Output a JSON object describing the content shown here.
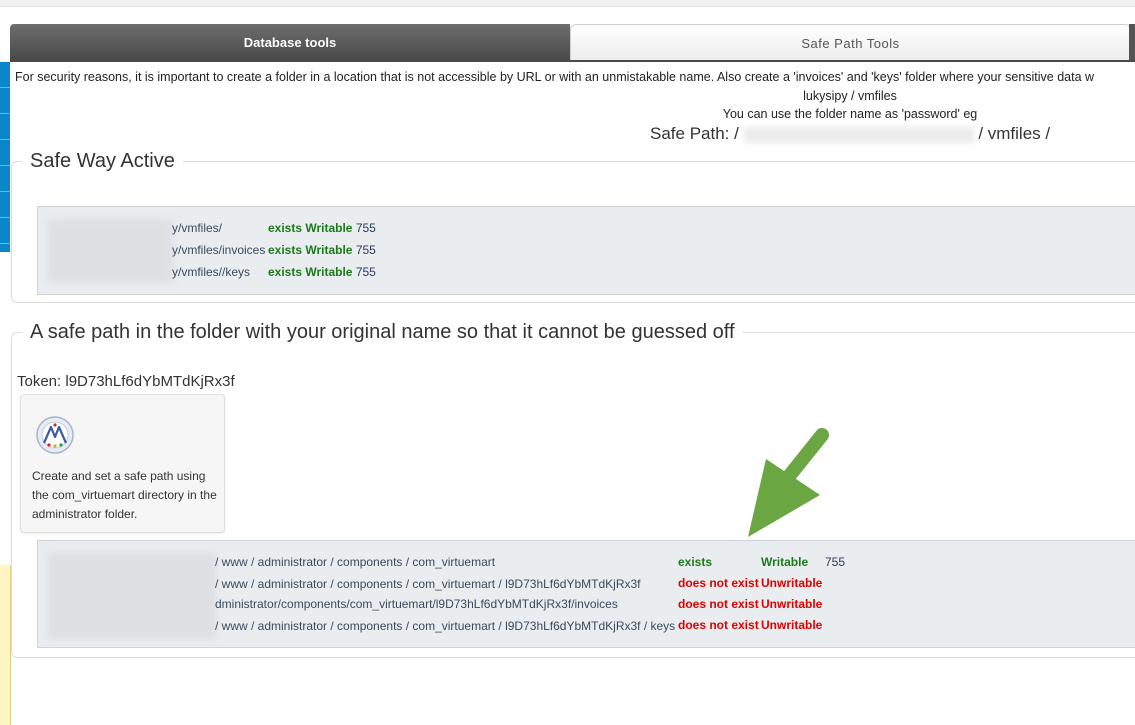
{
  "tabs": {
    "database": "Database tools",
    "safe_path": "Safe Path Tools"
  },
  "intro": {
    "line1": "For security reasons, it is important to create a folder in a location that is not accessible by URL or with an unmistakable name. Also create a 'invoices' and 'keys' folder where your sensitive data w",
    "line2": "lukysipy / vmfiles",
    "line3": "You can use the folder name as 'password' eg",
    "safe_path_label": "Safe Path: /",
    "safe_path_suffix": "/ vmfiles /"
  },
  "safe_way": {
    "title": "Safe Way Active",
    "rows": [
      {
        "path": "y/vmfiles/",
        "status": "exists Writable",
        "perm": "755"
      },
      {
        "path": "y/vmfiles/invoices",
        "status": "exists Writable",
        "perm": "755"
      },
      {
        "path": "y/vmfiles//keys",
        "status": "exists Writable",
        "perm": "755"
      }
    ]
  },
  "original_name": {
    "title": "A safe path in the folder with your original name so that it cannot be guessed off",
    "token": "Token: l9D73hLf6dYbMTdKjRx3f",
    "card_text": "Create and set a safe path using the com_virtuemart directory in the administrator folder.",
    "card_icon": "virtuemart-logo-icon",
    "rows": [
      {
        "path": "/ www / administrator / components / com_virtuemart",
        "exists": "exists",
        "writable": "Writable",
        "perm": "755",
        "ok": true
      },
      {
        "path": "/ www / administrator / components / com_virtuemart / l9D73hLf6dYbMTdKjRx3f",
        "exists": "does not exist",
        "writable": "Unwritable",
        "perm": "",
        "ok": false
      },
      {
        "path": "dministrator/components/com_virtuemart/l9D73hLf6dYbMTdKjRx3f/invoices",
        "exists": "does not exist",
        "writable": "Unwritable",
        "perm": "",
        "ok": false
      },
      {
        "path": "/ www / administrator / components / com_virtuemart / l9D73hLf6dYbMTdKjRx3f / keys",
        "exists": "does not exist",
        "writable": "Unwritable",
        "perm": "",
        "ok": false
      }
    ]
  },
  "colors": {
    "ok": "#1b7a1b",
    "bad": "#e00000",
    "arrow": "#6aa642",
    "tab_dark": "#4a4a4a"
  }
}
